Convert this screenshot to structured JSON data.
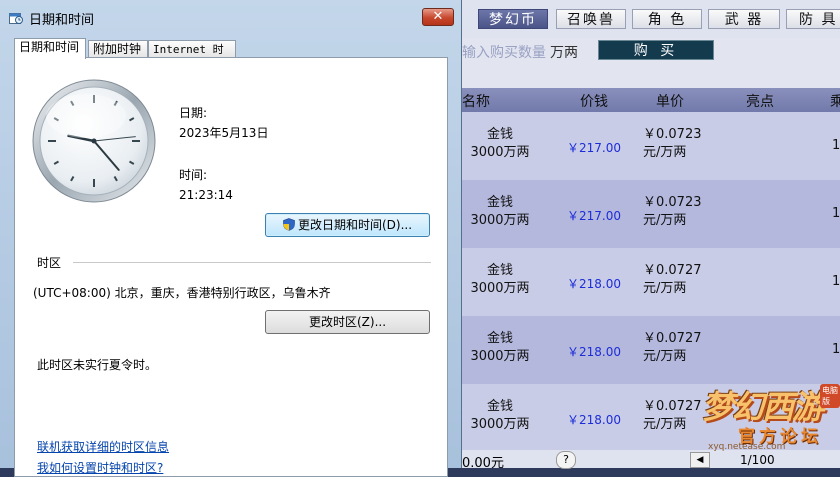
{
  "background_app": {
    "tabs": [
      {
        "label": "梦幻币",
        "active": true
      },
      {
        "label": "召唤兽",
        "active": false
      },
      {
        "label": "角 色",
        "active": false
      },
      {
        "label": "武 器",
        "active": false
      },
      {
        "label": "防 具",
        "active": false
      }
    ],
    "quantity_placeholder": "输入购买数量",
    "quantity_unit": "万两",
    "buy_button": "购 买",
    "columns": [
      "名称",
      "价钱",
      "单价",
      "亮点",
      "乘"
    ],
    "rows": [
      {
        "name_line1": "金钱",
        "name_line2": "3000万两",
        "price": "￥217.00",
        "unit_line1": "￥0.0723",
        "unit_line2": "元/万两"
      },
      {
        "name_line1": "金钱",
        "name_line2": "3000万两",
        "price": "￥217.00",
        "unit_line1": "￥0.0723",
        "unit_line2": "元/万两"
      },
      {
        "name_line1": "金钱",
        "name_line2": "3000万两",
        "price": "￥218.00",
        "unit_line1": "￥0.0727",
        "unit_line2": "元/万两"
      },
      {
        "name_line1": "金钱",
        "name_line2": "3000万两",
        "price": "￥218.00",
        "unit_line1": "￥0.0727",
        "unit_line2": "元/万两"
      },
      {
        "name_line1": "金钱",
        "name_line2": "3000万两",
        "price": "￥218.00",
        "unit_line1": "￥0.0727",
        "unit_line2": "元/万两"
      }
    ],
    "footer": {
      "amount": "0.00元",
      "help": "?",
      "prev": "◀",
      "page": "1/100"
    },
    "watermark": {
      "logo": "梦幻西游",
      "subtitle": "官方论坛",
      "url": "xyq.netease.com",
      "badge": "电脑版"
    }
  },
  "dialog": {
    "title": "日期和时间",
    "close_symbol": "✕",
    "tabs": [
      {
        "label": "日期和时间",
        "selected": true
      },
      {
        "label": "附加时钟",
        "selected": false
      },
      {
        "label": "Internet 时间",
        "selected": false
      }
    ],
    "clock": {
      "hour": 21,
      "minute": 23,
      "second": 14
    },
    "date_label": "日期:",
    "date_value": "2023年5月13日",
    "time_label": "时间:",
    "time_value": "21:23:14",
    "change_datetime_button": "更改日期和时间(D)...",
    "timezone_heading": "时区",
    "timezone_value": "(UTC+08:00) 北京，重庆，香港特别行政区，乌鲁木齐",
    "change_timezone_button": "更改时区(Z)...",
    "dst_note": "此时区未实行夏令时。",
    "link_timezone_info": "联机获取详细的时区信息",
    "link_set_clock": "我如何设置时钟和时区?"
  }
}
